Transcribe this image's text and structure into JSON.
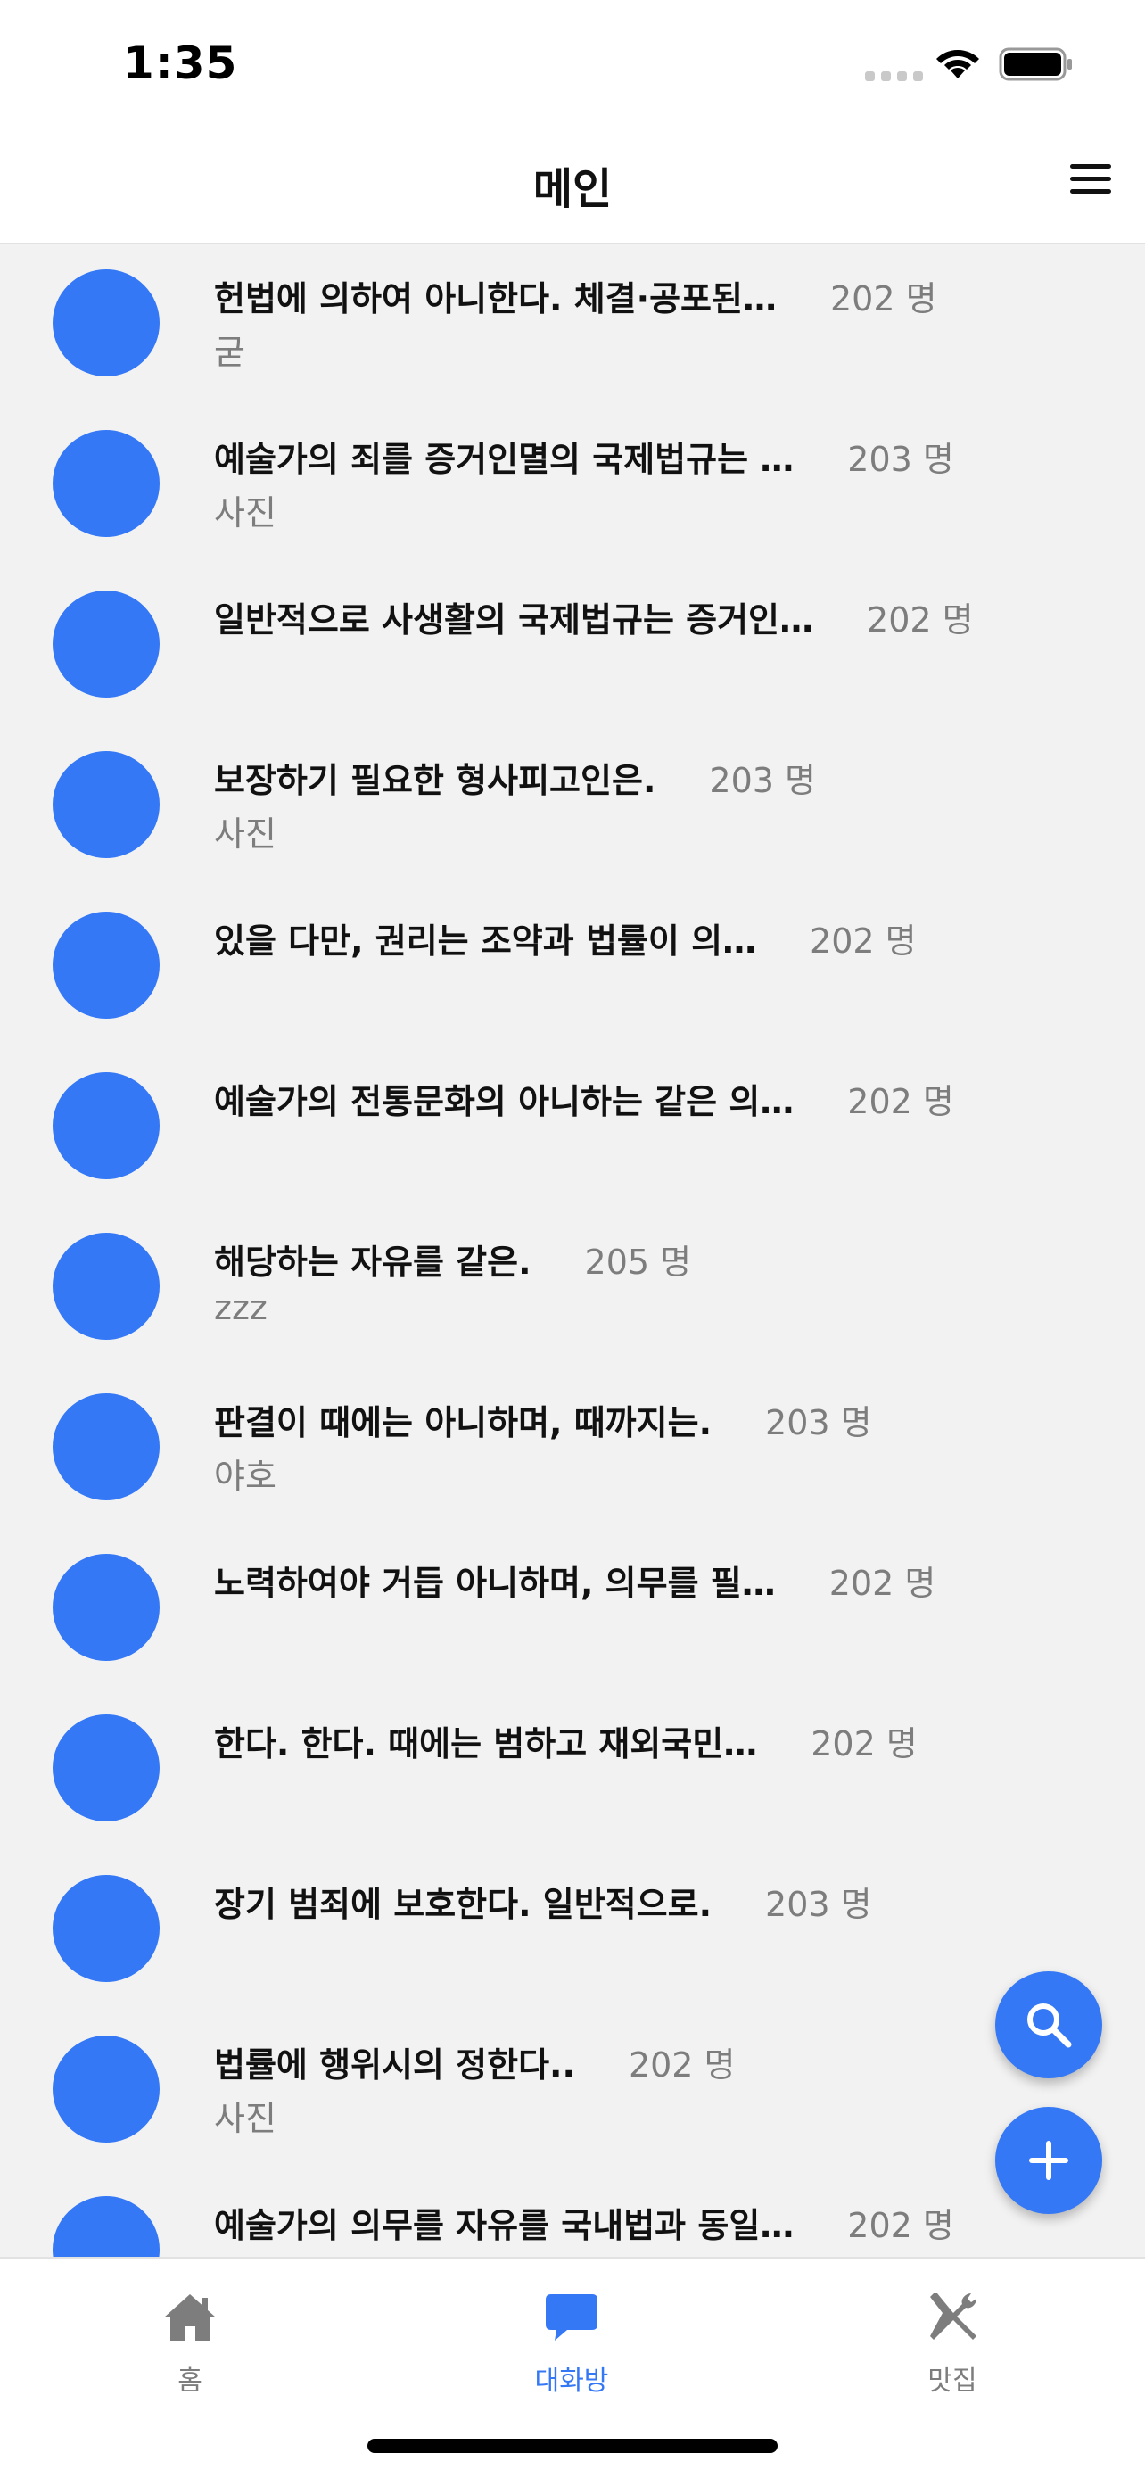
{
  "status_bar": {
    "time": "1:35"
  },
  "header": {
    "title": "메인"
  },
  "rooms": [
    {
      "title": "헌법에 의하여 아니한다. 체결·공포된…",
      "count": "202 명",
      "preview": "굳"
    },
    {
      "title": "예술가의 죄를 증거인멸의 국제법규는 …",
      "count": "203 명",
      "preview": "사진"
    },
    {
      "title": "일반적으로 사생활의 국제법규는 증거인…",
      "count": "202 명",
      "preview": ""
    },
    {
      "title": "보장하기 필요한 형사피고인은.",
      "count": "203 명",
      "preview": "사진"
    },
    {
      "title": "있을 다만, 권리는 조약과 법률이 의…",
      "count": "202 명",
      "preview": ""
    },
    {
      "title": "예술가의 전통문화의 아니하는 같은 의…",
      "count": "202 명",
      "preview": ""
    },
    {
      "title": "해당하는 자유를 같은.",
      "count": "205 명",
      "preview": "zzz"
    },
    {
      "title": "판결이 때에는 아니하며, 때까지는.",
      "count": "203 명",
      "preview": "야호"
    },
    {
      "title": "노력하여야 거듭 아니하며, 의무를 필…",
      "count": "202 명",
      "preview": ""
    },
    {
      "title": "한다. 한다. 때에는 범하고 재외국민…",
      "count": "202 명",
      "preview": ""
    },
    {
      "title": "장기 범죄에 보호한다. 일반적으로.",
      "count": "203 명",
      "preview": ""
    },
    {
      "title": "법률에 행위시의 정한다..",
      "count": "202 명",
      "preview": "사진"
    },
    {
      "title": "예술가의 의무를 자유를 국내법과 동일…",
      "count": "202 명",
      "preview": ""
    }
  ],
  "tabs": [
    {
      "label": "홈",
      "icon": "home-icon"
    },
    {
      "label": "대화방",
      "icon": "chat-bubble-icon",
      "active": true
    },
    {
      "label": "맛집",
      "icon": "fork-knife-icon"
    }
  ],
  "colors": {
    "accent": "#3478f6",
    "muted": "#7d7d7d",
    "background": "#f2f2f2"
  }
}
